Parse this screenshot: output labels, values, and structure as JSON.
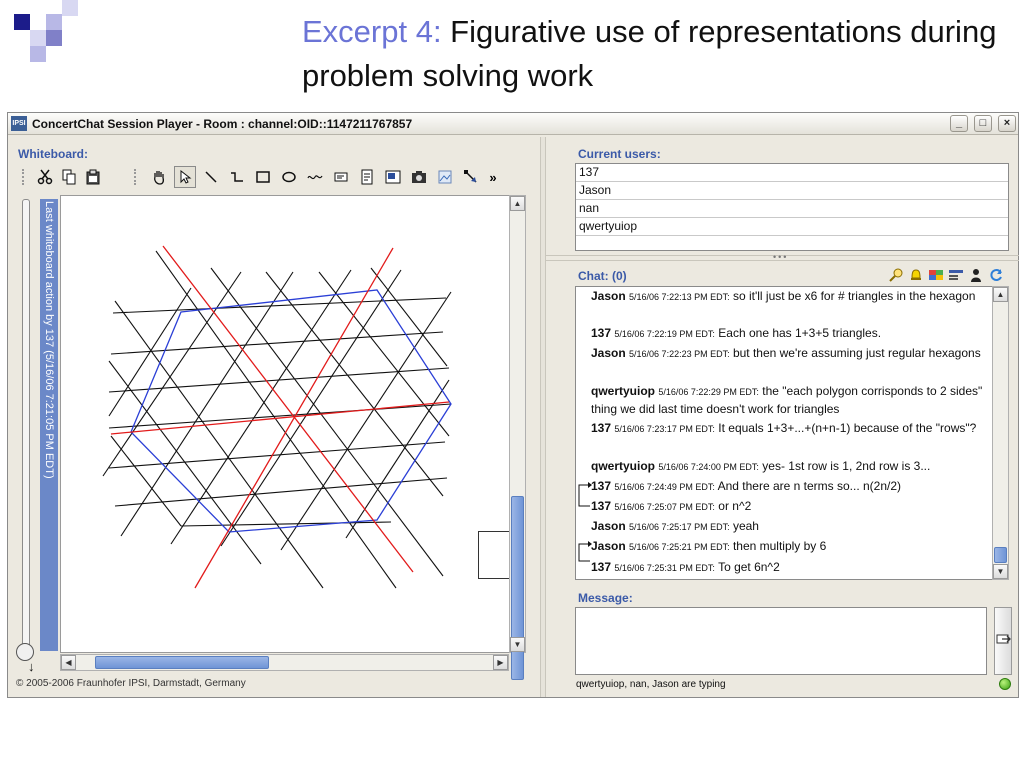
{
  "slide": {
    "title_accent": "Excerpt 4:",
    "title_rest": " Figurative use of representations during problem solving work"
  },
  "window": {
    "title": "ConcertChat Session Player - Room : channel:OID::1147211767857",
    "buttons": [
      "_",
      "□",
      "×"
    ]
  },
  "whiteboard": {
    "label": "Whiteboard:",
    "vertical_label": "Last whiteboard action by 137 (5/16/06 7:21:05 PM EDT)",
    "tools": [
      "cut-icon",
      "copy-icon",
      "paste-icon",
      "hand-icon",
      "pointer-icon",
      "line-icon",
      "connector-icon",
      "rectangle-icon",
      "ellipse-icon",
      "freehand-icon",
      "textbox-icon",
      "note-icon",
      "image-icon",
      "camera-icon",
      "picture-icon",
      "arrow-tool-icon",
      "more-icon"
    ],
    "more_label": "»",
    "copyright": "© 2005-2006 Fraunhofer IPSI, Darmstadt, Germany"
  },
  "users": {
    "label": "Current users:",
    "list": [
      "137",
      "Jason",
      "nan",
      "qwertyuiop"
    ]
  },
  "chat": {
    "label": "Chat: (0)",
    "messages": [
      {
        "who": "Jason",
        "ts": "5/16/06 7:22:13 PM EDT:",
        "text": "so it'll just be x6 for # triangles in the hexagon"
      },
      {
        "who": "137",
        "ts": "5/16/06 7:22:19 PM EDT:",
        "text": "Each one has 1+3+5 triangles."
      },
      {
        "who": "Jason",
        "ts": "5/16/06 7:22:23 PM EDT:",
        "text": "but then we're assuming just regular hexagons"
      },
      {
        "who": "qwertyuiop",
        "ts": "5/16/06 7:22:29 PM EDT:",
        "text": "the \"each polygon corrisponds to 2 sides\" thing we did last time doesn't work for triangles"
      },
      {
        "who": "137",
        "ts": "5/16/06 7:23:17 PM EDT:",
        "text": "It equals 1+3+...+(n+n-1) because of the \"rows\"?"
      },
      {
        "who": "qwertyuiop",
        "ts": "5/16/06 7:24:00 PM EDT:",
        "text": "yes- 1st row is 1, 2nd row is 3..."
      },
      {
        "who": "137",
        "ts": "5/16/06 7:24:49 PM EDT:",
        "text": "And there are n terms so... n(2n/2)"
      },
      {
        "who": "137",
        "ts": "5/16/06 7:25:07 PM EDT:",
        "text": "or n^2"
      },
      {
        "who": "Jason",
        "ts": "5/16/06 7:25:17 PM EDT:",
        "text": "yeah"
      },
      {
        "who": "Jason",
        "ts": "5/16/06 7:25:21 PM EDT:",
        "text": "then multiply by 6"
      },
      {
        "who": "137",
        "ts": "5/16/06 7:25:31 PM EDT:",
        "text": "To get 6n^2"
      }
    ]
  },
  "message": {
    "label": "Message:",
    "value": "",
    "typing_status": "qwertyuiop, nan, Jason are typing"
  },
  "colors": {
    "accent_title": "#6b74d6",
    "panel_label": "#3b5aa8",
    "hexagon": "#2b3fd6",
    "red_lines": "#e21b1b",
    "grid_lines": "#111111"
  }
}
